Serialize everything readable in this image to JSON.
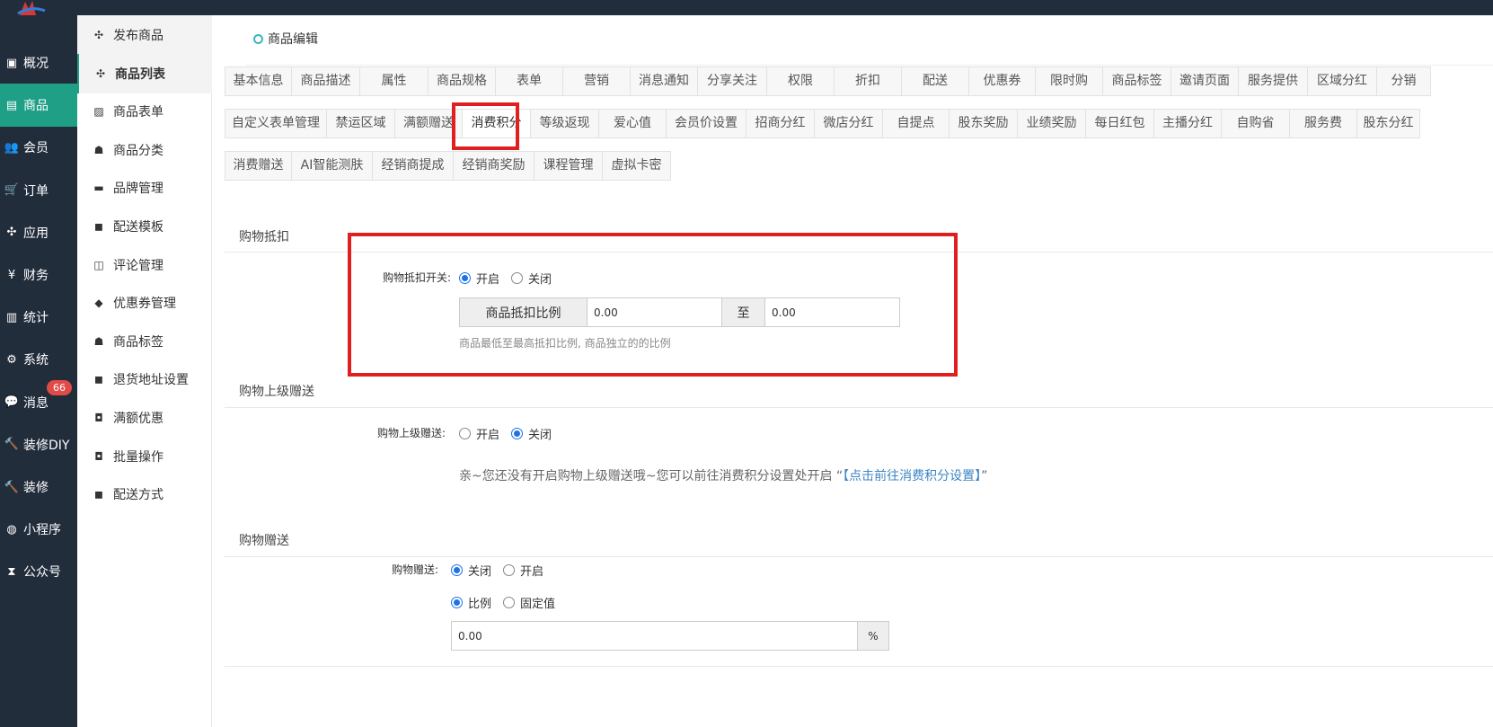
{
  "mainnav": [
    {
      "icon": "monitor-icon",
      "glyph": "▣",
      "label": "概况"
    },
    {
      "icon": "goods-icon",
      "glyph": "▤",
      "label": "商品",
      "active": true
    },
    {
      "icon": "users-icon",
      "glyph": "👥",
      "label": "会员"
    },
    {
      "icon": "cart-icon",
      "glyph": "🛒",
      "label": "订单"
    },
    {
      "icon": "apps-icon",
      "glyph": "✣",
      "label": "应用"
    },
    {
      "icon": "yen-icon",
      "glyph": "¥",
      "label": "财务"
    },
    {
      "icon": "bar-chart-icon",
      "glyph": "▥",
      "label": "统计"
    },
    {
      "icon": "gears-icon",
      "glyph": "⚙",
      "label": "系统"
    },
    {
      "icon": "chat-icon",
      "glyph": "💬",
      "label": "消息",
      "badge": "66"
    },
    {
      "icon": "gavel-icon",
      "glyph": "🔨",
      "label": "装修DIY"
    },
    {
      "icon": "gavel-icon",
      "glyph": "🔨",
      "label": "装修"
    },
    {
      "icon": "wechat-icon",
      "glyph": "◍",
      "label": "小程序"
    },
    {
      "icon": "hourglass-icon",
      "glyph": "⧗",
      "label": "公众号"
    }
  ],
  "subnav": [
    {
      "icon": "cubes-icon",
      "glyph": "✣",
      "label": "发布商品"
    },
    {
      "icon": "cubes-icon",
      "glyph": "✣",
      "label": "商品列表",
      "active": true
    },
    {
      "icon": "file-excel-icon",
      "glyph": "▨",
      "label": "商品表单"
    },
    {
      "icon": "sitemap-icon",
      "glyph": "☗",
      "label": "商品分类"
    },
    {
      "icon": "briefcase-icon",
      "glyph": "▬",
      "label": "品牌管理"
    },
    {
      "icon": "truck-icon",
      "glyph": "◼",
      "label": "配送模板"
    },
    {
      "icon": "columns-icon",
      "glyph": "◫",
      "label": "评论管理"
    },
    {
      "icon": "tags-icon",
      "glyph": "◆",
      "label": "优惠券管理"
    },
    {
      "icon": "sitemap-icon",
      "glyph": "☗",
      "label": "商品标签"
    },
    {
      "icon": "truck-icon",
      "glyph": "◼",
      "label": "退货地址设置"
    },
    {
      "icon": "gift-icon",
      "glyph": "◘",
      "label": "满额优惠"
    },
    {
      "icon": "gift-icon",
      "glyph": "◘",
      "label": "批量操作"
    },
    {
      "icon": "truck-icon",
      "glyph": "◼",
      "label": "配送方式"
    }
  ],
  "breadcrumb": "商品编辑",
  "tabs_row1": [
    {
      "label": "基本信息",
      "w": 75
    },
    {
      "label": "商品描述",
      "w": 76
    },
    {
      "label": "属性",
      "w": 76
    },
    {
      "label": "商品规格",
      "w": 75
    },
    {
      "label": "表单",
      "w": 75
    },
    {
      "label": "营销",
      "w": 75
    },
    {
      "label": "消息通知",
      "w": 75
    },
    {
      "label": "分享关注",
      "w": 77
    },
    {
      "label": "权限",
      "w": 75
    },
    {
      "label": "折扣",
      "w": 75
    },
    {
      "label": "配送",
      "w": 75
    },
    {
      "label": "优惠券",
      "w": 74
    },
    {
      "label": "限时购",
      "w": 75
    },
    {
      "label": "商品标签",
      "w": 76
    },
    {
      "label": "邀请页面",
      "w": 75
    },
    {
      "label": "服务提供",
      "w": 77
    },
    {
      "label": "区域分红",
      "w": 77
    },
    {
      "label": "分销",
      "w": 60
    }
  ],
  "tabs_row2": [
    {
      "label": "自定义表单管理",
      "w": 114
    },
    {
      "label": "禁运区域",
      "w": 76
    },
    {
      "label": "满额赠送",
      "w": 75
    },
    {
      "label": "消费积分",
      "w": 76,
      "active": true
    },
    {
      "label": "等级返现",
      "w": 76
    },
    {
      "label": "爱心值",
      "w": 75
    },
    {
      "label": "会员价设置",
      "w": 89
    },
    {
      "label": "招商分红",
      "w": 76
    },
    {
      "label": "微店分红",
      "w": 76
    },
    {
      "label": "自提点",
      "w": 74
    },
    {
      "label": "股东奖励",
      "w": 76
    },
    {
      "label": "业绩奖励",
      "w": 76
    },
    {
      "label": "每日红包",
      "w": 76
    },
    {
      "label": "主播分红",
      "w": 75
    },
    {
      "label": "自购省",
      "w": 76
    },
    {
      "label": "服务费",
      "w": 75
    },
    {
      "label": "股东分红",
      "w": 70
    }
  ],
  "tabs_row3": [
    {
      "label": "消费赠送",
      "w": 75
    },
    {
      "label": "AI智能测肤",
      "w": 90
    },
    {
      "label": "经销商提成",
      "w": 90
    },
    {
      "label": "经销商奖励",
      "w": 90
    },
    {
      "label": "课程管理",
      "w": 76
    },
    {
      "label": "虚拟卡密",
      "w": 76
    }
  ],
  "deduction": {
    "section_title": "购物抵扣",
    "switch_label": "购物抵扣开关:",
    "on_label": "开启",
    "off_label": "关闭",
    "selected": "on",
    "ratio_addon": "商品抵扣比例",
    "min_value": "0.00",
    "to_label": "至",
    "max_value": "0.00",
    "help": "商品最低至最高抵扣比例, 商品独立的的比例"
  },
  "superior": {
    "section_title": "购物上级赠送",
    "label": "购物上级赠送:",
    "on_label": "开启",
    "off_label": "关闭",
    "selected": "off",
    "notice_prefix": "亲~您还没有开启购物上级赠送哦~您可以前往消费积分设置处开启 “",
    "notice_link": "【点击前往消费积分设置】",
    "notice_suffix": "”"
  },
  "gift": {
    "section_title": "购物赠送",
    "label": "购物赠送:",
    "off_label": "关闭",
    "on_label": "开启",
    "selected": "off",
    "ratio_label": "比例",
    "fixed_label": "固定值",
    "mode_selected": "ratio",
    "value": "0.00",
    "unit": "%"
  }
}
